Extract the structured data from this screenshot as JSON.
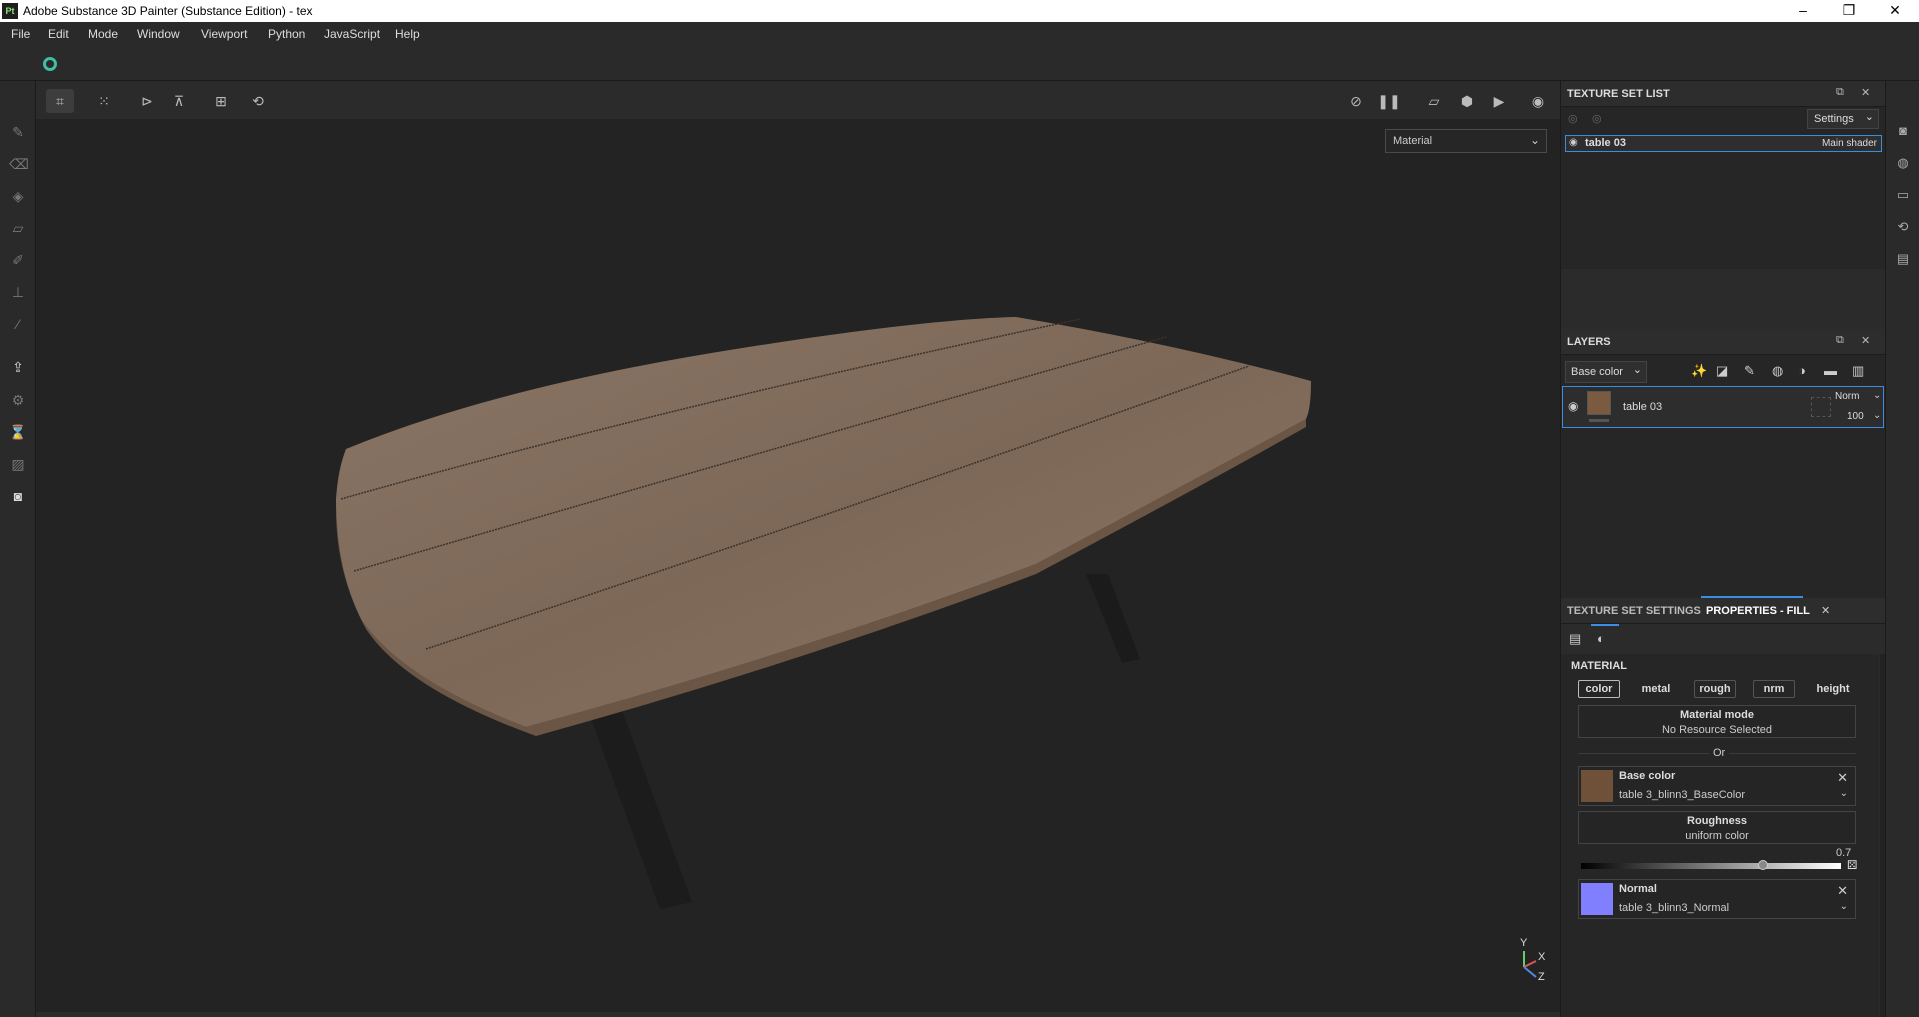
{
  "window": {
    "logo": "Pt",
    "title": "Adobe Substance 3D Painter (Substance Edition) - tex",
    "minimize": "–",
    "maximize": "❐",
    "close": "✕"
  },
  "menu": [
    "File",
    "Edit",
    "Mode",
    "Window",
    "Viewport",
    "Python",
    "JavaScript",
    "Help"
  ],
  "viewport": {
    "mode_dropdown": "Material",
    "axis": {
      "y": "Y",
      "x": "X",
      "z": "Z"
    }
  },
  "texture_set_list": {
    "title": "TEXTURE SET LIST",
    "settings_label": "Settings",
    "items": [
      {
        "name": "table 03",
        "shader": "Main shader"
      }
    ]
  },
  "layers": {
    "title": "LAYERS",
    "channel_dropdown": "Base color",
    "items": [
      {
        "name": "table 03",
        "blend": "Norm",
        "opacity": "100"
      }
    ]
  },
  "properties": {
    "tab_inactive": "TEXTURE SET SETTINGS",
    "tab_active": "PROPERTIES - FILL",
    "section_title": "MATERIAL",
    "channels": [
      "color",
      "metal",
      "rough",
      "nrm",
      "height"
    ],
    "material_mode_label": "Material mode",
    "material_mode_value": "No Resource Selected",
    "or_label": "Or",
    "base_color": {
      "label": "Base color",
      "value": "table 3_blinn3_BaseColor"
    },
    "roughness": {
      "label": "Roughness",
      "value": "uniform color",
      "slider_value": "0.7",
      "slider_fraction": 0.7
    },
    "normal": {
      "label": "Normal",
      "value": "table 3_blinn3_Normal"
    }
  },
  "colors": {
    "accent": "#3b8de0",
    "normal_swatch": "#8080ff",
    "wood": "#8c7462"
  }
}
